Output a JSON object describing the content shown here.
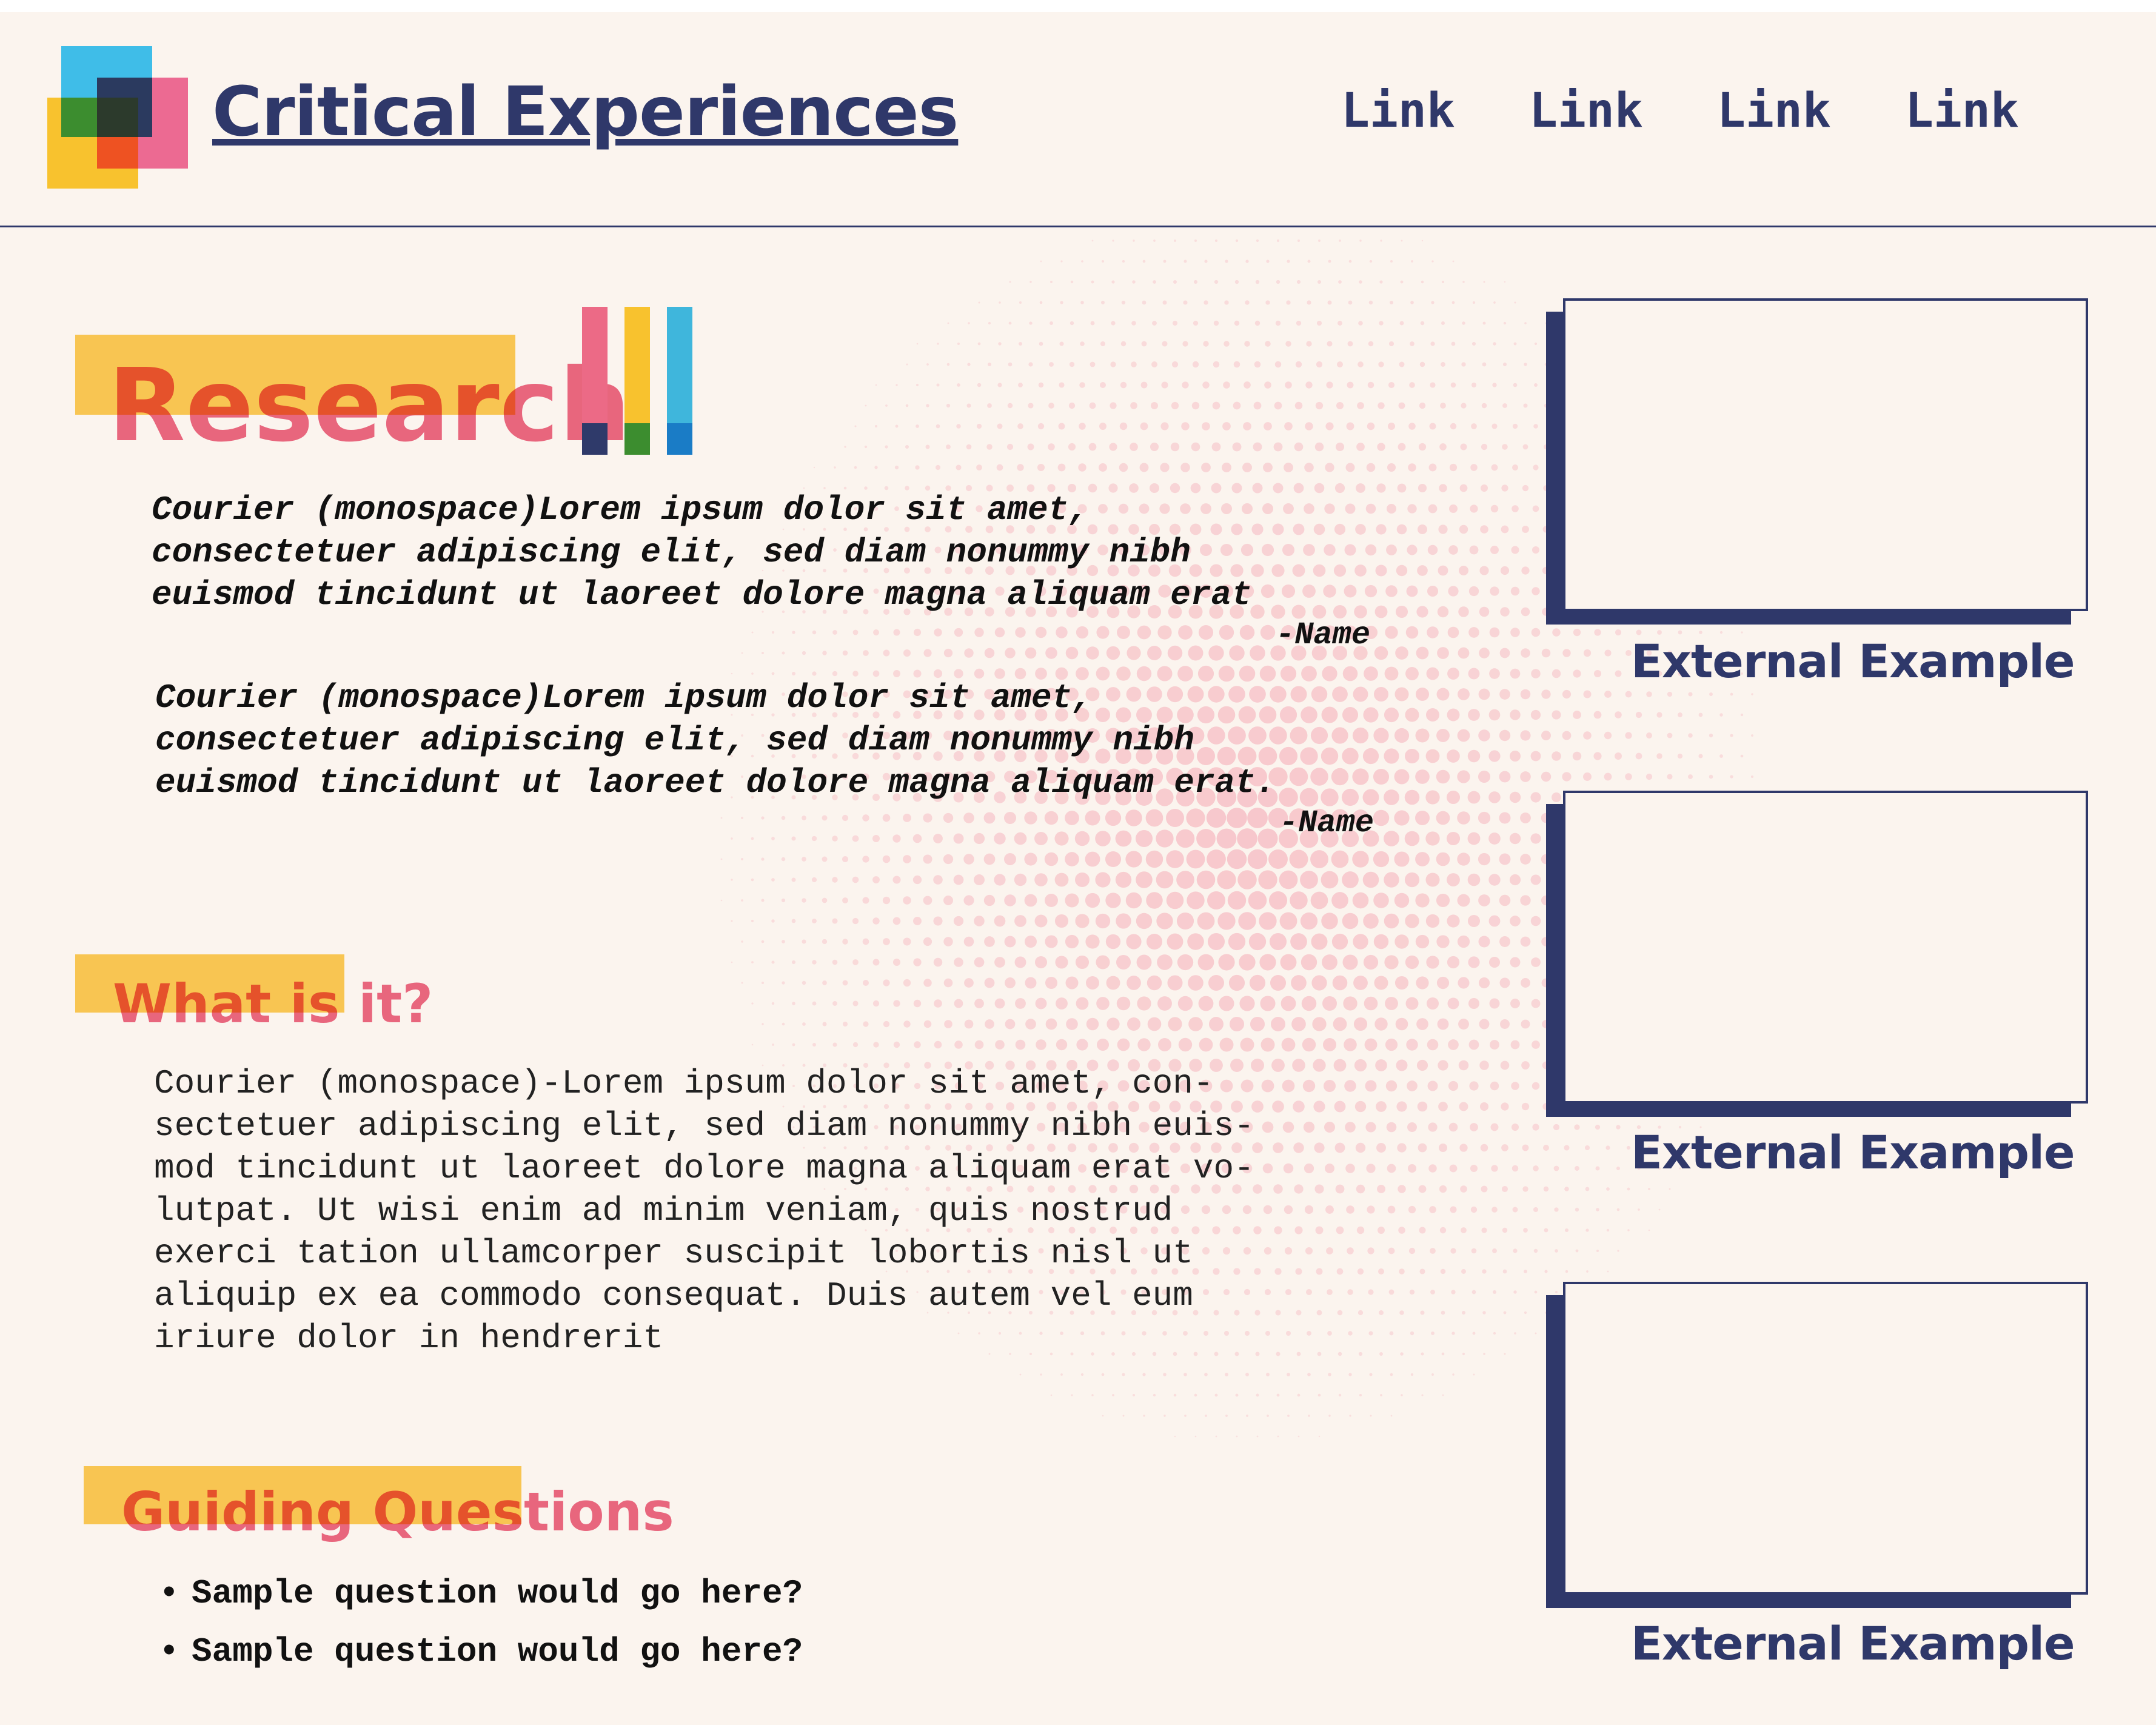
{
  "header": {
    "brand": "Critical Experiences",
    "nav": [
      "Link",
      "Link",
      "Link",
      "Link"
    ]
  },
  "logo": {
    "colors": [
      "#3fbde8",
      "#ec6a92",
      "#f8c22e",
      "#2b3a5f",
      "#3c8d2f",
      "#ee5222"
    ]
  },
  "research": {
    "title": "Research",
    "bar_colors": [
      "#ec6a86",
      "#f8c22e",
      "#3fb6dc"
    ],
    "bar_cap_colors": [
      "#2f3a6a",
      "#3c8d2f",
      "#1a7cc6"
    ],
    "quotes": [
      {
        "text": "Courier (monospace)Lorem ipsum dolor sit amet,\nconsectetuer adipiscing elit, sed diam nonummy nibh\neuismod tincidunt ut laoreet dolore magna aliquam erat",
        "attribution": "-Name"
      },
      {
        "text": "Courier (monospace)Lorem ipsum dolor sit amet,\nconsectetuer adipiscing elit, sed diam nonummy nibh\neuismod tincidunt ut laoreet dolore magna aliquam erat.",
        "attribution": "-Name"
      }
    ]
  },
  "what_is_it": {
    "title": "What is it?",
    "body": "Courier (monospace)-Lorem ipsum dolor sit amet, con-\nsectetuer adipiscing elit, sed diam nonummy nibh euis-\nmod tincidunt ut laoreet dolore magna aliquam erat vo-\nlutpat. Ut wisi enim ad minim veniam, quis nostrud\nexerci tation ullamcorper suscipit lobortis nisl ut\naliquip ex ea commodo consequat. Duis autem vel eum\niriure dolor in hendrerit"
  },
  "guiding_questions": {
    "title": "Guiding Questions",
    "bullet": "•",
    "items": [
      "Sample question would go here?",
      "Sample question would go here?"
    ]
  },
  "examples": [
    {
      "label": "External Example"
    },
    {
      "label": "External Example"
    },
    {
      "label": "External Example"
    }
  ],
  "colors": {
    "navy": "#2f386a",
    "pink": "#ec6a86",
    "yellow": "#f8c552",
    "background": "#fbf4ee",
    "halftone": "#f6b8c0"
  }
}
